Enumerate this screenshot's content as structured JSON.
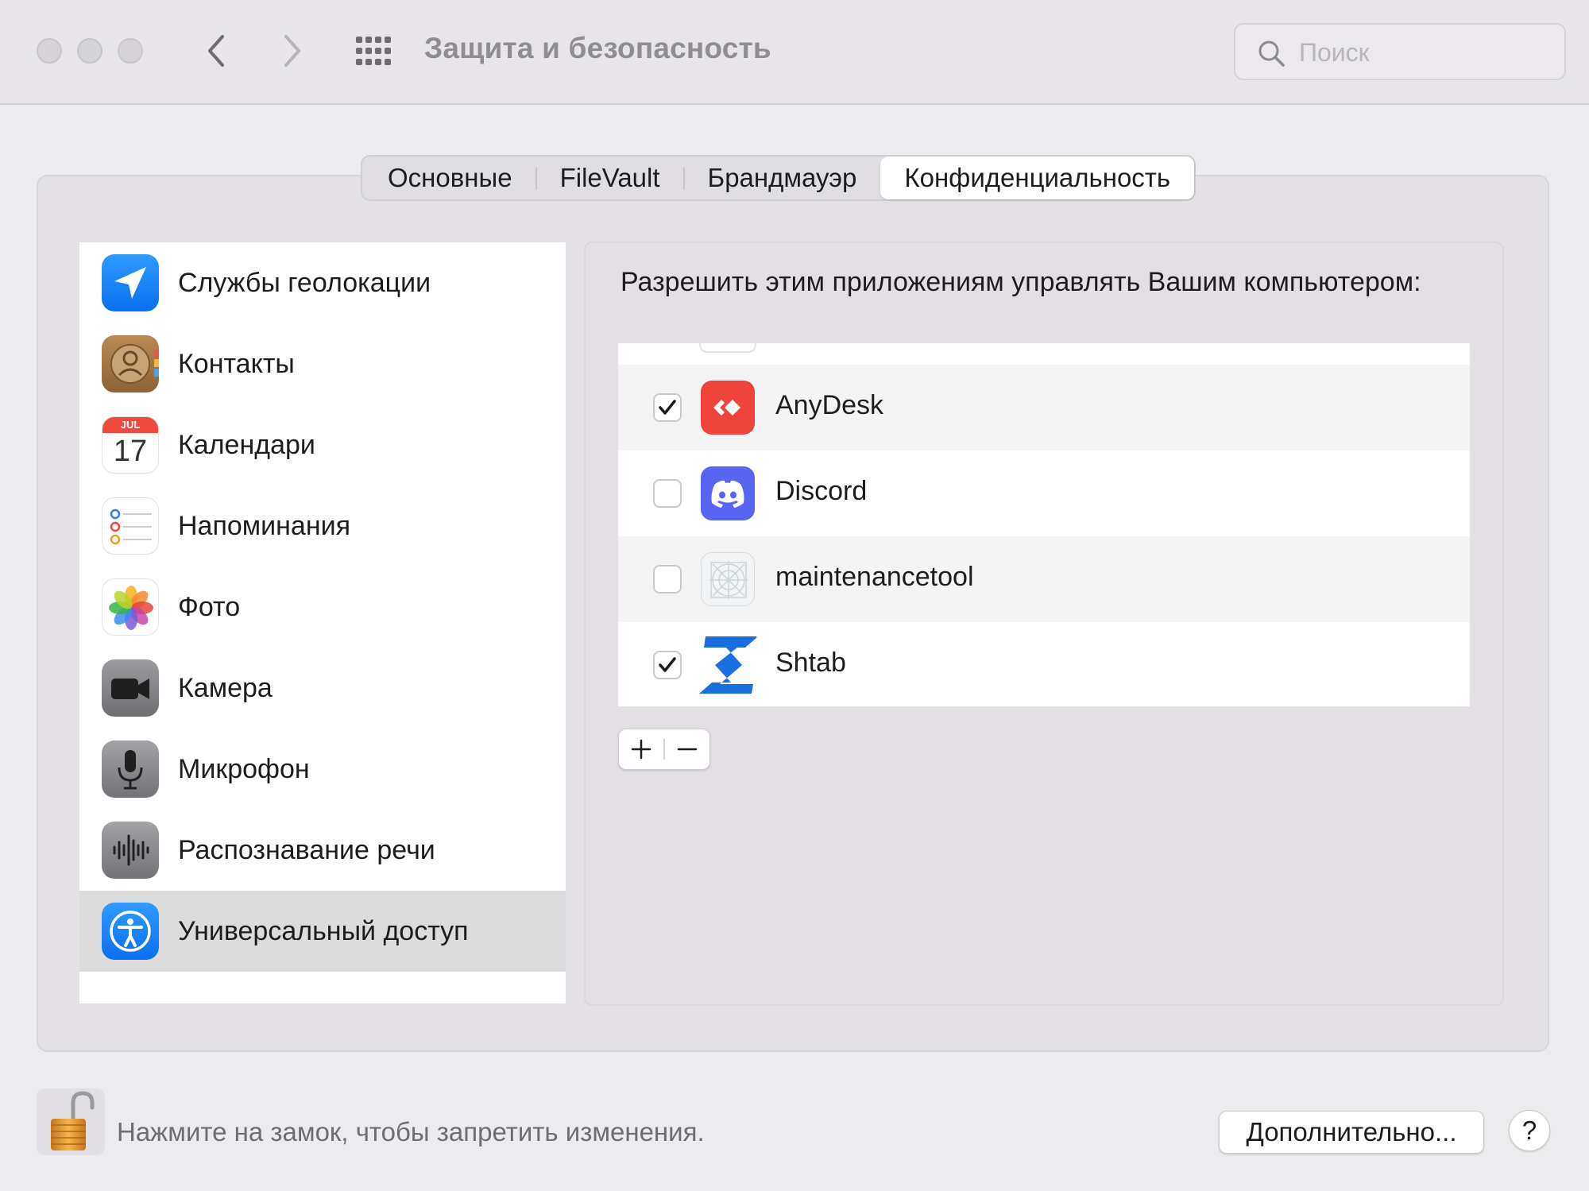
{
  "window": {
    "title": "Защита и безопасность"
  },
  "search": {
    "placeholder": "Поиск"
  },
  "tabs": [
    {
      "label": "Основные",
      "active": false
    },
    {
      "label": "FileVault",
      "active": false
    },
    {
      "label": "Брандмауэр",
      "active": false
    },
    {
      "label": "Конфиденциальность",
      "active": true
    }
  ],
  "sidebar": {
    "items": [
      {
        "label": "Службы геолокации",
        "icon": "location-icon",
        "selected": false
      },
      {
        "label": "Контакты",
        "icon": "contacts-icon",
        "selected": false
      },
      {
        "label": "Календари",
        "icon": "calendar-icon",
        "selected": false,
        "calendar_month": "JUL",
        "calendar_day": "17"
      },
      {
        "label": "Напоминания",
        "icon": "reminders-icon",
        "selected": false
      },
      {
        "label": "Фото",
        "icon": "photos-icon",
        "selected": false
      },
      {
        "label": "Камера",
        "icon": "camera-icon",
        "selected": false
      },
      {
        "label": "Микрофон",
        "icon": "microphone-icon",
        "selected": false
      },
      {
        "label": "Распознавание речи",
        "icon": "speech-recognition-icon",
        "selected": false
      },
      {
        "label": "Универсальный доступ",
        "icon": "accessibility-icon",
        "selected": true
      }
    ]
  },
  "panel": {
    "heading": "Разрешить этим приложениям управлять Вашим компьютером:",
    "apps": [
      {
        "name": "AnyDesk",
        "checked": true,
        "icon": "anydesk-icon",
        "color": "#ef443b"
      },
      {
        "name": "Discord",
        "checked": false,
        "icon": "discord-icon",
        "color": "#5865f2"
      },
      {
        "name": "maintenancetool",
        "checked": false,
        "icon": "maintenancetool-icon",
        "color": "#e8eef0"
      },
      {
        "name": "Shtab",
        "checked": true,
        "icon": "shtab-icon",
        "color": "#1a73e8"
      }
    ],
    "add_label": "+",
    "remove_label": "−"
  },
  "footer": {
    "lock_text": "Нажмите на замок, чтобы запретить изменения.",
    "more_button": "Дополнительно...",
    "help_button": "?"
  }
}
